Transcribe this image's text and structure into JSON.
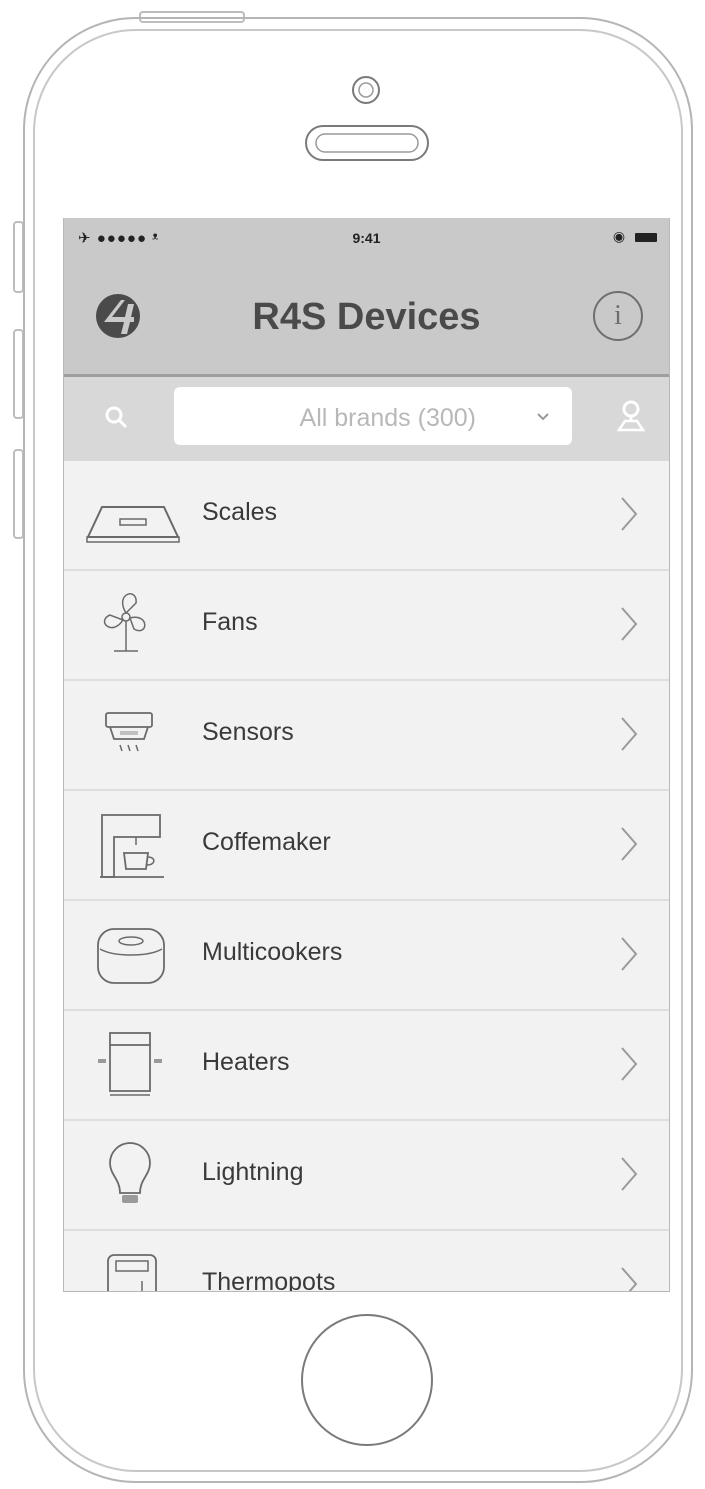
{
  "status_bar": {
    "signal": "✈ ●●●●● ᵜ",
    "time": "9:41",
    "right": "◉"
  },
  "nav": {
    "title": "R4S Devices",
    "info_label": "i"
  },
  "filter": {
    "brand_select": "All brands (300)"
  },
  "categories": [
    {
      "label": "Scales",
      "icon": "scale-icon"
    },
    {
      "label": "Fans",
      "icon": "fan-icon"
    },
    {
      "label": "Sensors",
      "icon": "sensor-icon"
    },
    {
      "label": "Coffemaker",
      "icon": "coffeemaker-icon"
    },
    {
      "label": "Multicookers",
      "icon": "multicooker-icon"
    },
    {
      "label": "Heaters",
      "icon": "heater-icon"
    },
    {
      "label": "Lightning",
      "icon": "light-bulb-icon"
    },
    {
      "label": "Thermopots",
      "icon": "thermopot-icon"
    }
  ],
  "colors": {
    "nav_background": "#c9c9c9",
    "search_background": "#d8d8d8",
    "list_background": "#f2f2f2",
    "text": "#3a3a3a"
  }
}
